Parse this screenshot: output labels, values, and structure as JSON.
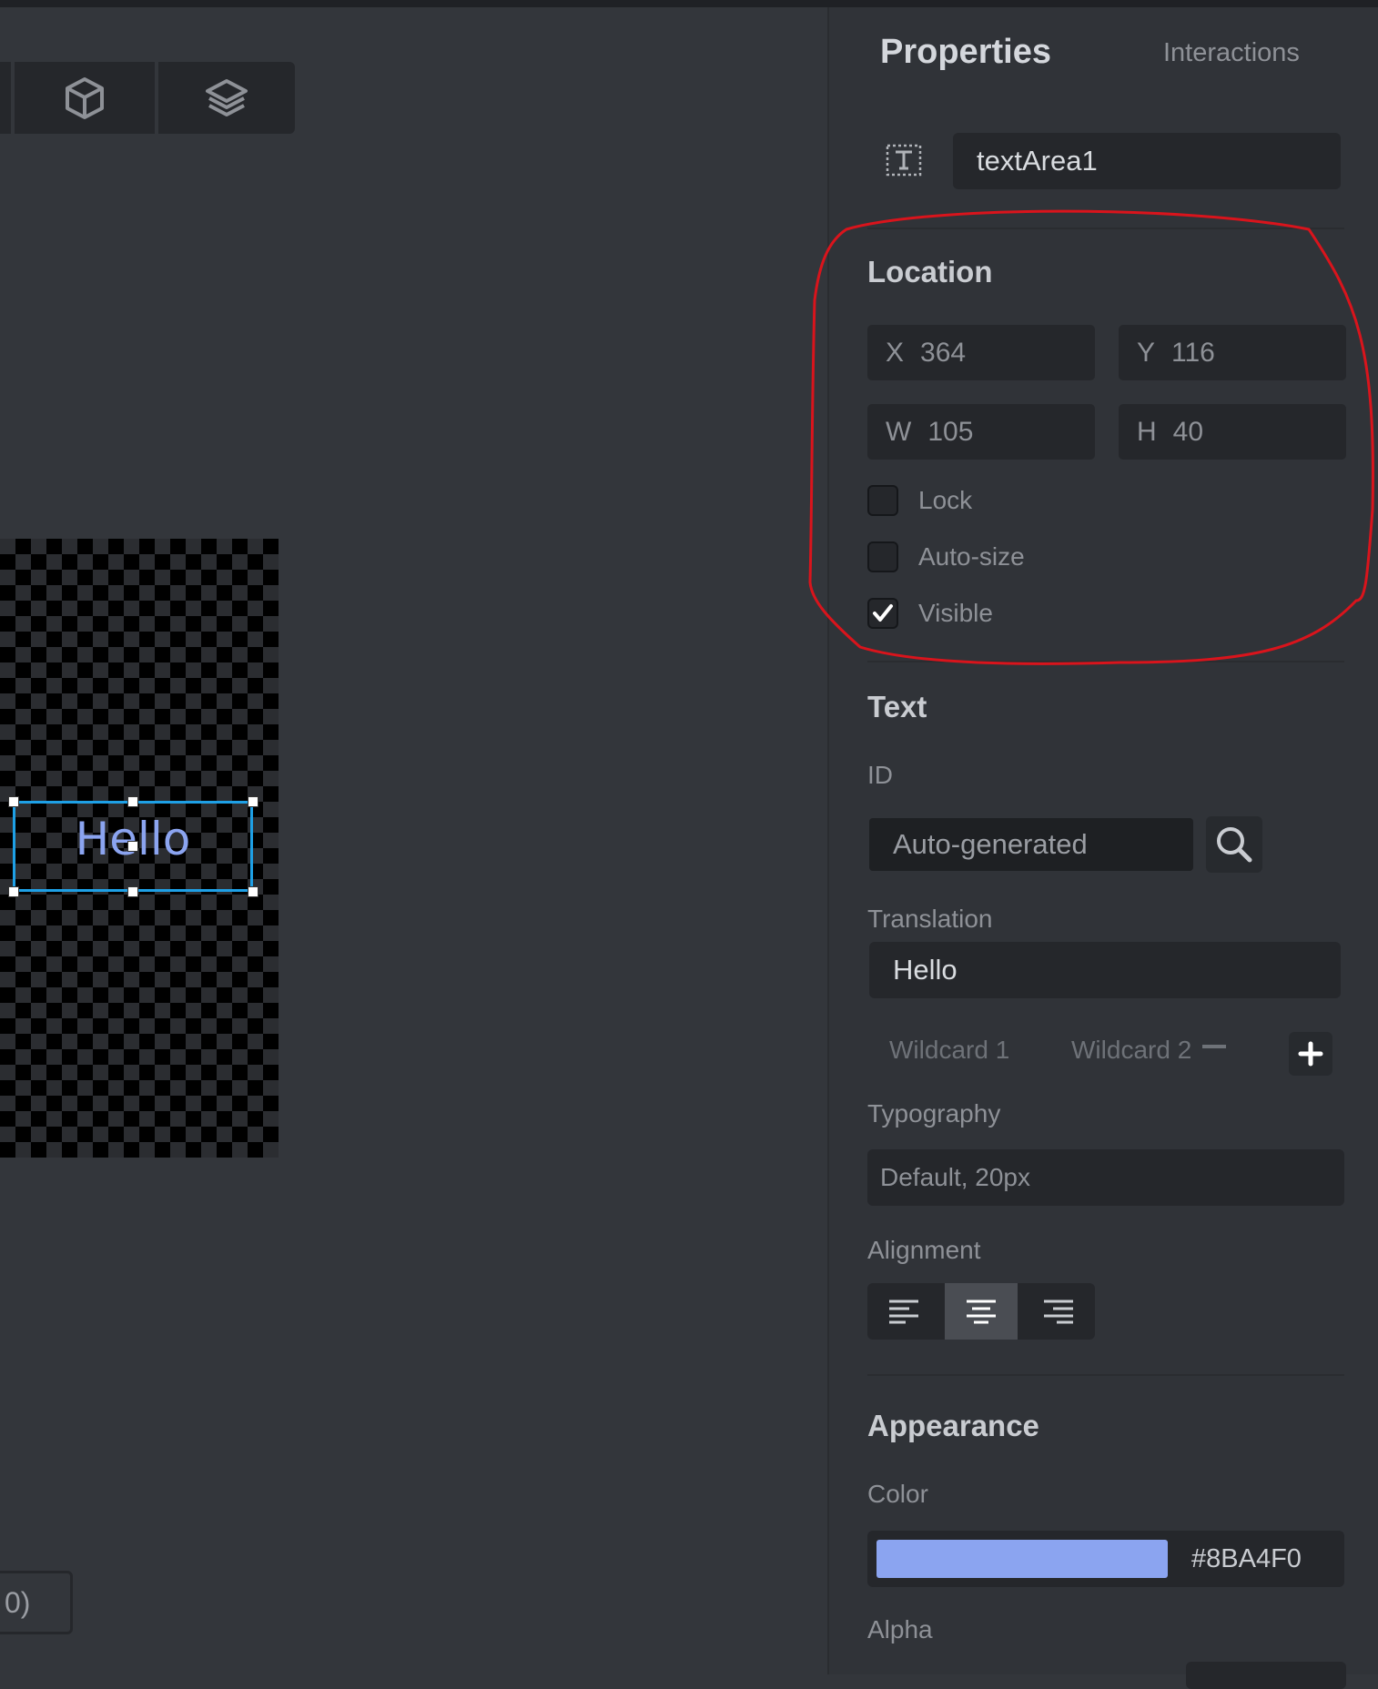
{
  "panel": {
    "tab_active": "Properties",
    "tab_inactive": "Interactions",
    "name_value": "textArea1"
  },
  "location": {
    "title": "Location",
    "x_key": "X",
    "x_value": "364",
    "y_key": "Y",
    "y_value": "116",
    "w_key": "W",
    "w_value": "105",
    "h_key": "H",
    "h_value": "40",
    "lock_label": "Lock",
    "lock_checked": false,
    "autosize_label": "Auto-size",
    "autosize_checked": false,
    "visible_label": "Visible",
    "visible_checked": true
  },
  "text": {
    "title": "Text",
    "id_label": "ID",
    "id_value": "Auto-generated",
    "translation_label": "Translation",
    "translation_value": "Hello",
    "wildcard1": "Wildcard 1",
    "wildcard2": "Wildcard 2",
    "typography_label": "Typography",
    "typography_value": "Default, 20px",
    "alignment_label": "Alignment",
    "alignment_selected": "center"
  },
  "appearance": {
    "title": "Appearance",
    "color_label": "Color",
    "color_hex": "#8BA4F0",
    "alpha_label": "Alpha"
  },
  "canvas": {
    "widget_text": "Hello",
    "bottom_chip_text": "0)"
  },
  "colors": {
    "selection": "#1ea0e6",
    "text_color": "#8BA4F0",
    "annotation": "#d9141c"
  }
}
